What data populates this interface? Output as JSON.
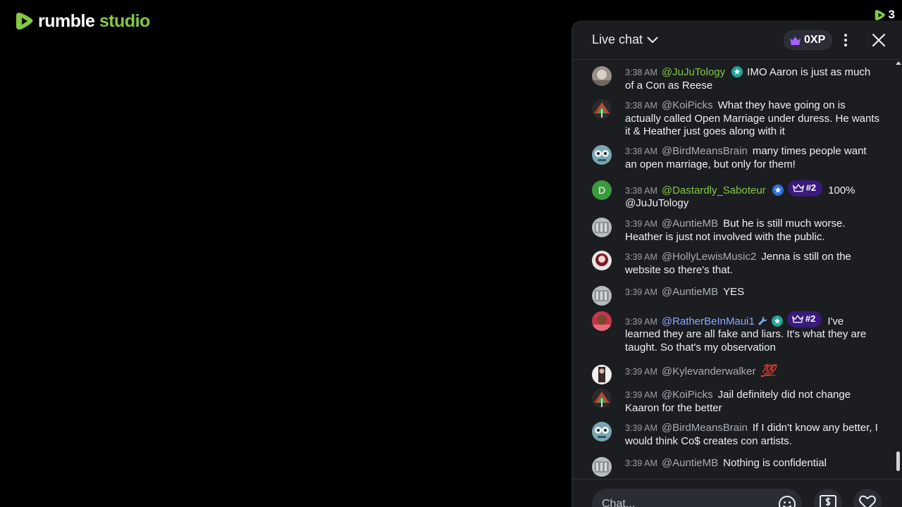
{
  "app": {
    "brand": "rumble",
    "product": "studio"
  },
  "viewer_count": "3",
  "chat": {
    "title": "Live chat",
    "xp_label": "0XP",
    "input_placeholder": "Chat...",
    "messages": [
      {
        "time": "3:38 AM",
        "user": "@JuJuTology",
        "text": "IMO Aaron is just as much of a Con as Reese"
      },
      {
        "time": "3:38 AM",
        "user": "@KoiPicks",
        "text": "What they have going on is actually called Open Marriage under duress. He wants it & Heather just goes along with it"
      },
      {
        "time": "3:38 AM",
        "user": "@BirdMeansBrain",
        "text": "many times people want an open marriage, but only for them!"
      },
      {
        "time": "3:38 AM",
        "user": "@Dastardly_Saboteur",
        "badge": "#2",
        "text": "100% @JuJuTology",
        "avatar_letter": "D"
      },
      {
        "time": "3:39 AM",
        "user": "@AuntieMB",
        "text": "But he is still much worse. Heather is just not involved with the public."
      },
      {
        "time": "3:39 AM",
        "user": "@HollyLewisMusic2",
        "text": "Jenna is still on the website so there's that."
      },
      {
        "time": "3:39 AM",
        "user": "@AuntieMB",
        "text": "YES"
      },
      {
        "time": "3:39 AM",
        "user": "@RatherBeInMaui1",
        "badge": "#2",
        "text": "I've learned they are all fake and liars. It's what they are taught. So that's my observation"
      },
      {
        "time": "3:39 AM",
        "user": "@Kylevanderwalker",
        "text": "💯"
      },
      {
        "time": "3:39 AM",
        "user": "@KoiPicks",
        "text": "Jail definitely did not change Kaaron for the better"
      },
      {
        "time": "3:39 AM",
        "user": "@BirdMeansBrain",
        "text": "If I didn't know any better, I would think Co$ creates con artists."
      },
      {
        "time": "3:39 AM",
        "user": "@AuntieMB",
        "text": "Nothing is confidential"
      }
    ]
  },
  "colors": {
    "accent": "#85c742",
    "panel": "#1b1d21",
    "badge": "#3a1a7a"
  }
}
